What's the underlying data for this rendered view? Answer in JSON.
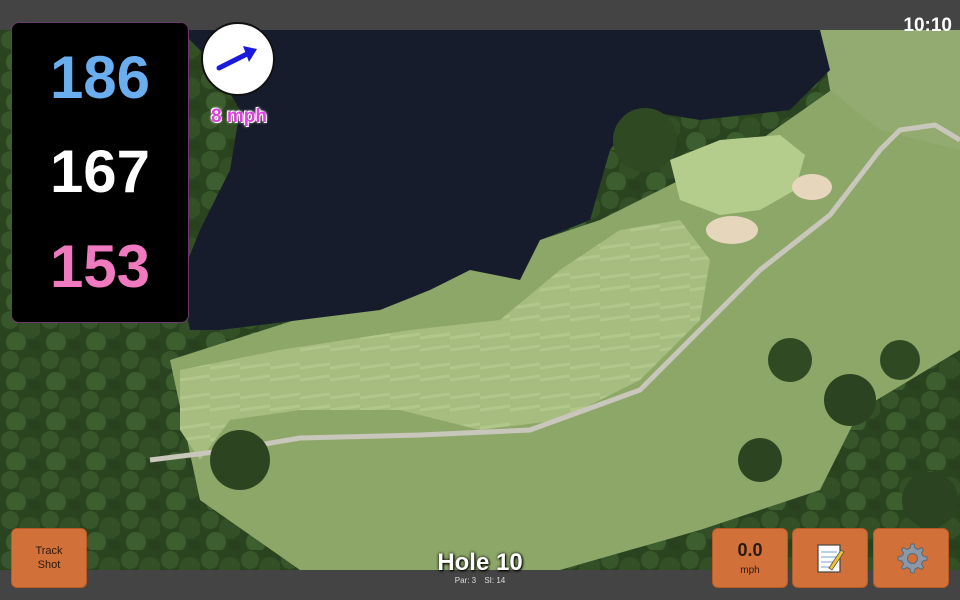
{
  "clock": "10:10",
  "distances": {
    "back": {
      "value": "186",
      "color": "#6aaef0"
    },
    "center": {
      "value": "167",
      "color": "#ffffff"
    },
    "front": {
      "value": "153",
      "color": "#f07ac0"
    }
  },
  "wind": {
    "speed_label": "8 mph",
    "arrow_icon": "arrow-right-up-icon",
    "arrow_color": "#1a1adc"
  },
  "buttons": {
    "track_shot_line1": "Track",
    "track_shot_line2": "Shot",
    "speed_value": "0.0",
    "speed_unit": "mph",
    "notes_icon": "notepad-icon",
    "settings_icon": "gear-icon"
  },
  "hole": {
    "title": "Hole 10",
    "par": "Par: 3",
    "si": "SI: 14"
  },
  "colors": {
    "button_bg": "#d2703a",
    "water": "#171c2c",
    "fairway": "#a9bf82",
    "rough": "#8ea86a",
    "trees": "#2f4a22"
  }
}
